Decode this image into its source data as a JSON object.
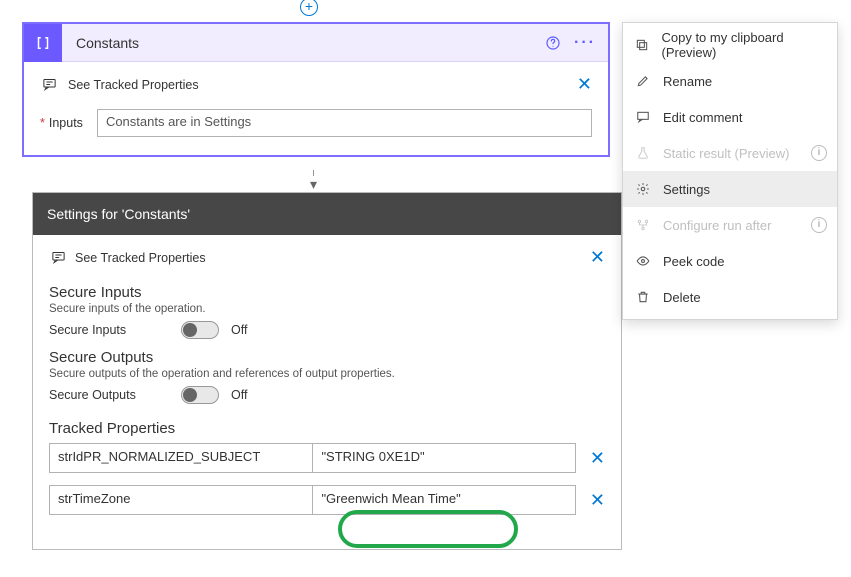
{
  "constantsPanel": {
    "title": "Constants",
    "trackedLabel": "See Tracked Properties",
    "inputsLabel": "Inputs",
    "inputsValue": "Constants are in Settings"
  },
  "settingsPanel": {
    "title": "Settings for 'Constants'",
    "trackedLabel": "See Tracked Properties",
    "secureInputs": {
      "title": "Secure Inputs",
      "desc": "Secure inputs of the operation.",
      "rowLabel": "Secure Inputs",
      "state": "Off"
    },
    "secureOutputs": {
      "title": "Secure Outputs",
      "desc": "Secure outputs of the operation and references of output properties.",
      "rowLabel": "Secure Outputs",
      "state": "Off"
    },
    "trackedPropsTitle": "Tracked Properties",
    "rows": [
      {
        "key": "strIdPR_NORMALIZED_SUBJECT",
        "value": "\"STRING 0XE1D\""
      },
      {
        "key": "strTimeZone",
        "value": "\"Greenwich Mean Time\""
      }
    ]
  },
  "contextMenu": {
    "items": [
      {
        "label": "Copy to my clipboard (Preview)"
      },
      {
        "label": "Rename"
      },
      {
        "label": "Edit comment"
      },
      {
        "label": "Static result (Preview)"
      },
      {
        "label": "Settings"
      },
      {
        "label": "Configure run after"
      },
      {
        "label": "Peek code"
      },
      {
        "label": "Delete"
      }
    ]
  },
  "glyphs": {
    "req": "*"
  }
}
